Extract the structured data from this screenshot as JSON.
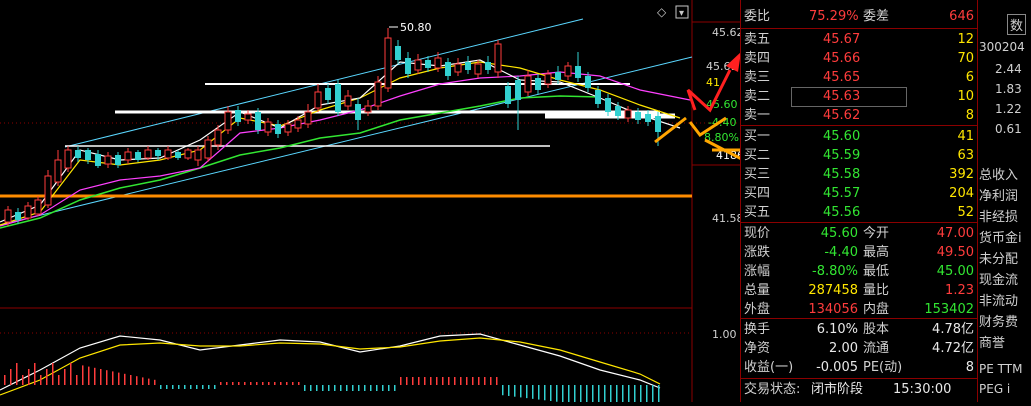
{
  "chart": {
    "peak_label": "50.80",
    "axis_labels": [
      "45.62",
      "41.58",
      "1.00"
    ],
    "right_marker_labels": [
      "45.61",
      "41",
      "45.60",
      "-4.40",
      "8.80%",
      "4186"
    ],
    "colors": {
      "up": "#ff3c3c",
      "down": "#32d0d0",
      "ma5": "#ffffff",
      "ma10": "#ffe600",
      "ma20": "#ff40ff",
      "ma60": "#32e632",
      "hline": "#ff8c00"
    }
  },
  "quote": {
    "weibi_label": "委比",
    "weibi_value": "75.29%",
    "weicha_label": "委差",
    "weicha_value": "646",
    "asks": [
      {
        "label": "卖五",
        "price": "45.67",
        "vol": "12"
      },
      {
        "label": "卖四",
        "price": "45.66",
        "vol": "70"
      },
      {
        "label": "卖三",
        "price": "45.65",
        "vol": "6"
      },
      {
        "label": "卖二",
        "price": "45.63",
        "vol": "10"
      },
      {
        "label": "卖一",
        "price": "45.62",
        "vol": "8"
      }
    ],
    "bids": [
      {
        "label": "买一",
        "price": "45.60",
        "vol": "41"
      },
      {
        "label": "买二",
        "price": "45.59",
        "vol": "63"
      },
      {
        "label": "买三",
        "price": "45.58",
        "vol": "392"
      },
      {
        "label": "买四",
        "price": "45.57",
        "vol": "204"
      },
      {
        "label": "买五",
        "price": "45.56",
        "vol": "52"
      }
    ],
    "stats": [
      {
        "l1": "现价",
        "v1": "45.60",
        "c1": "green",
        "l2": "今开",
        "v2": "47.00",
        "c2": "red"
      },
      {
        "l1": "涨跌",
        "v1": "-4.40",
        "c1": "green",
        "l2": "最高",
        "v2": "49.50",
        "c2": "red"
      },
      {
        "l1": "涨幅",
        "v1": "-8.80%",
        "c1": "green",
        "l2": "最低",
        "v2": "45.00",
        "c2": "green"
      },
      {
        "l1": "总量",
        "v1": "287458",
        "c1": "yellow",
        "l2": "量比",
        "v2": "1.23",
        "c2": "red"
      },
      {
        "l1": "外盘",
        "v1": "134056",
        "c1": "red",
        "l2": "内盘",
        "v2": "153402",
        "c2": "green"
      }
    ],
    "stats2": [
      {
        "l1": "换手",
        "v1": "6.10%",
        "l2": "股本",
        "v2": "4.78亿"
      },
      {
        "l1": "净资",
        "v1": "2.00",
        "l2": "流通",
        "v2": "4.72亿"
      },
      {
        "l1": "收益(一)",
        "v1": "-0.005",
        "l2": "PE(动)",
        "v2": "8"
      }
    ],
    "status_label": "交易状态:",
    "status_value": "闭市阶段",
    "status_time": "15:30:00"
  },
  "side": {
    "top": "数",
    "code": "300204",
    "nums": [
      "2.44",
      "1.83",
      "1.22",
      "0.61"
    ],
    "items": [
      "总收入",
      "净利润",
      "非经损",
      "货币金i",
      "未分配",
      "现金流",
      "非流动",
      "财务费",
      "商誉"
    ],
    "pe1": "PE TTM",
    "pe2": "PEG i"
  }
}
